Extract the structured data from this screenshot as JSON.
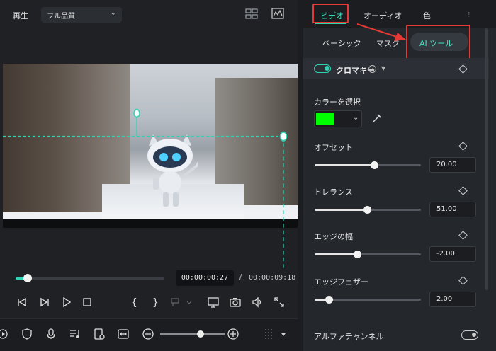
{
  "preview": {
    "play_label": "再生",
    "quality": "フル品質",
    "current_time": "00:00:00:27",
    "separator": "/",
    "total_time": "00:00:09:18",
    "progress": 0.08
  },
  "timeline_toolbar": {
    "zoom_level": 0.62
  },
  "tabs": {
    "video": "ビデオ",
    "audio": "オーディオ",
    "color": "色"
  },
  "subtabs": {
    "basic": "ベーシック",
    "mask": "マスク",
    "ai_tools": "AI ツール"
  },
  "chroma": {
    "title": "クロマキー",
    "help": "?",
    "select_color_label": "カラーを選択",
    "selected_color": "#00ff00",
    "offset": {
      "label": "オフセット",
      "value": "20.00",
      "fraction": 0.56
    },
    "tolerance": {
      "label": "トレランス",
      "value": "51.00",
      "fraction": 0.49
    },
    "edge_width": {
      "label": "エッジの幅",
      "value": "-2.00",
      "fraction": 0.4
    },
    "edge_feather": {
      "label": "エッジフェザー",
      "value": "2.00",
      "fraction": 0.13
    },
    "alpha_channel": {
      "label": "アルファチャンネル",
      "enabled": false
    }
  },
  "colors": {
    "accent": "#2fd3b3",
    "highlight_box": "#e53935"
  }
}
